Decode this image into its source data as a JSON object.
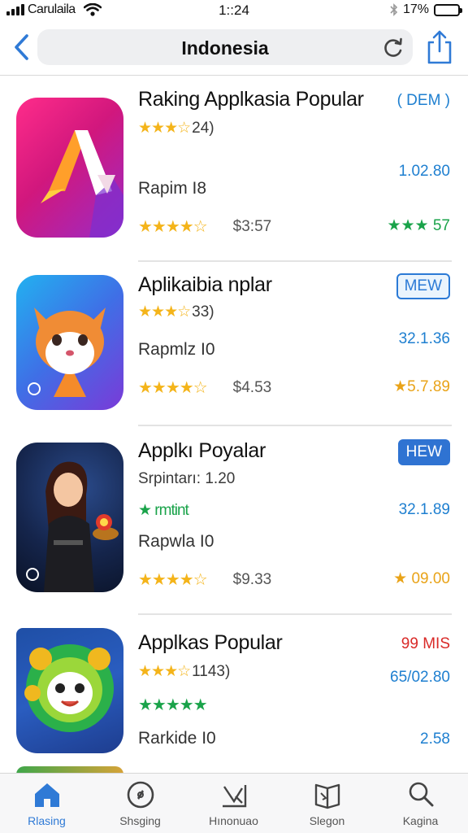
{
  "status_bar": {
    "carrier": "Carulaila",
    "time": "1::24",
    "battery_percent": "17%",
    "battery_level": 0.17
  },
  "nav": {
    "address": "Indonesia",
    "accent": "#2f7ad6"
  },
  "apps": [
    {
      "name": "Raking Applkasia Popular",
      "badge": "( DEM )",
      "badge_style": "plain",
      "rating_text": "24)",
      "rating_stars": 3.5,
      "right1": "1.02.80",
      "sub": "Rapim I8",
      "stars2": 3.5,
      "price": "$3:57",
      "right2": "★★★ 57",
      "right2_style": "green",
      "icon": "gradient-a-logo-icon"
    },
    {
      "name": "Aplikaibia nplar",
      "badge": "MEW",
      "badge_style": "outline",
      "rating_text": "33)",
      "rating_stars": 3.5,
      "right1": "32.1.36",
      "sub": "Rapmlz I0",
      "stars2": 3.5,
      "price": "$4.53",
      "right2": "★5.7.89",
      "right2_style": "gold",
      "icon": "fox-mascot-icon"
    },
    {
      "name": "Applkı Poyalar",
      "badge": "HEW",
      "badge_style": "filled",
      "rating_text": "Srpintarı: 1.20",
      "rating_stars": 0,
      "right1": "32.1.89",
      "sub_green": "★ rmtint",
      "sub": "Rapwla I0",
      "stars2": 3.5,
      "price": "$9.33",
      "right2": "★ 09.00",
      "right2_style": "gold",
      "icon": "hero-character-icon"
    },
    {
      "name": "Applkas Popular",
      "badge": "99 MIS",
      "badge_style": "plain-red",
      "rating_text": "1143)",
      "rating_stars": 3.5,
      "right1": "65/02.80",
      "sub_stars_green": "★★★★★",
      "sub": "Rarkide I0",
      "right2": "2.58",
      "right2_style": "blue",
      "icon": "lion-mascot-icon"
    }
  ],
  "tabs": [
    {
      "label": "Rlasing",
      "icon": "home-icon",
      "active": true
    },
    {
      "label": "Shsging",
      "icon": "compass-icon",
      "active": false
    },
    {
      "label": "Hınonuao",
      "icon": "trend-icon",
      "active": false
    },
    {
      "label": "Slegon",
      "icon": "book-icon",
      "active": false
    },
    {
      "label": "Kagina",
      "icon": "search-icon",
      "active": false
    }
  ]
}
